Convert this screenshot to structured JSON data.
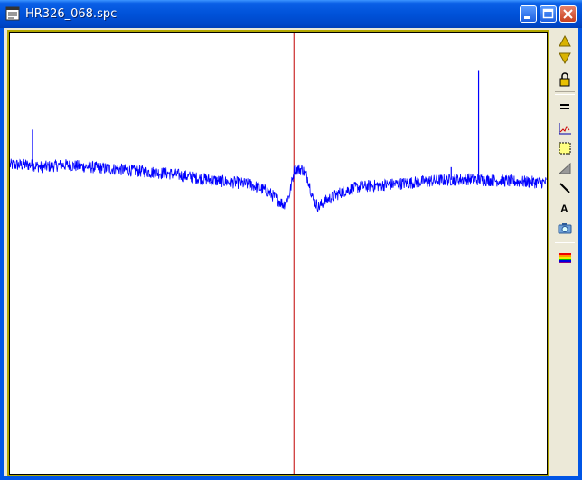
{
  "window": {
    "title": "HR326_068.spc"
  },
  "colors": {
    "plot_frame": "#b2a700",
    "spectrum": "#0000ff",
    "cursor": "#c00000",
    "titlebar": "#0052d9"
  },
  "toolbar": {
    "icons": [
      "arrow-up-icon",
      "arrow-down-icon",
      "lock-icon",
      "equals-icon",
      "chart-peak-icon",
      "select-region-icon",
      "gradient-icon",
      "line-icon",
      "text-icon",
      "camera-icon",
      "rainbow-icon"
    ]
  },
  "chart_data": {
    "type": "line",
    "title": "",
    "xlabel": "",
    "ylabel": "",
    "grid": false,
    "axes_visible": false,
    "ylim": [
      0,
      1
    ],
    "xlim": [
      0,
      1
    ],
    "cursor_x": 0.529,
    "series": [
      {
        "points": [
          [
            0.0,
            0.7
          ],
          [
            0.04,
            0.7
          ],
          [
            0.06,
            0.695
          ],
          [
            0.1,
            0.7
          ],
          [
            0.15,
            0.695
          ],
          [
            0.2,
            0.69
          ],
          [
            0.25,
            0.685
          ],
          [
            0.3,
            0.68
          ],
          [
            0.35,
            0.67
          ],
          [
            0.38,
            0.665
          ],
          [
            0.42,
            0.66
          ],
          [
            0.45,
            0.655
          ],
          [
            0.48,
            0.64
          ],
          [
            0.5,
            0.62
          ],
          [
            0.51,
            0.61
          ],
          [
            0.52,
            0.63
          ],
          [
            0.53,
            0.69
          ],
          [
            0.545,
            0.69
          ],
          [
            0.555,
            0.67
          ],
          [
            0.565,
            0.62
          ],
          [
            0.575,
            0.605
          ],
          [
            0.59,
            0.62
          ],
          [
            0.62,
            0.64
          ],
          [
            0.65,
            0.65
          ],
          [
            0.7,
            0.655
          ],
          [
            0.75,
            0.66
          ],
          [
            0.8,
            0.665
          ],
          [
            0.85,
            0.668
          ],
          [
            0.9,
            0.665
          ],
          [
            0.95,
            0.662
          ],
          [
            1.0,
            0.66
          ]
        ],
        "spikes": [
          {
            "x": 0.042,
            "top": 0.78
          },
          {
            "x": 0.822,
            "top": 0.695
          },
          {
            "x": 0.873,
            "top": 0.915
          }
        ]
      }
    ]
  }
}
